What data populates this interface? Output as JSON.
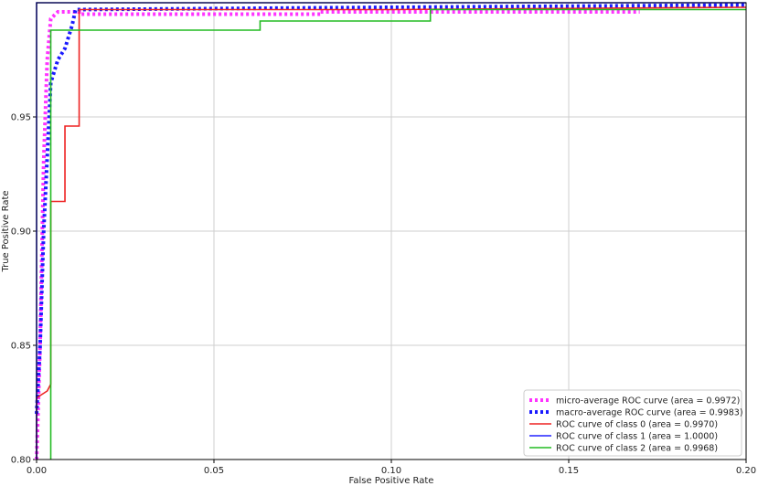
{
  "chart_data": {
    "type": "line",
    "title": "",
    "xlabel": "False Positive Rate",
    "ylabel": "True Positive Rate",
    "xlim": [
      0.0,
      0.2
    ],
    "ylim": [
      0.8,
      1.0
    ],
    "grid": true,
    "legend_position": "bottom-right",
    "x_ticks": [
      "0.00",
      "0.05",
      "0.10",
      "0.15",
      "0.20"
    ],
    "y_ticks": [
      "0.80",
      "0.85",
      "0.90",
      "0.95"
    ],
    "series": [
      {
        "name": "micro-average ROC curve (area = 0.9972)",
        "color": "#ff33ff",
        "style": "dotted",
        "x": [
          0.0,
          0.001,
          0.002,
          0.003,
          0.004,
          0.006,
          0.012,
          0.012,
          0.08,
          0.08,
          0.17
        ],
        "y": [
          0.8,
          0.85,
          0.93,
          0.975,
          0.993,
          0.996,
          0.996,
          0.995,
          0.995,
          0.996,
          0.996
        ]
      },
      {
        "name": "macro-average ROC curve (area = 0.9983)",
        "color": "#1a1aff",
        "style": "dotted",
        "x": [
          0.0,
          0.001,
          0.002,
          0.004,
          0.006,
          0.008,
          0.01,
          0.011,
          0.1,
          0.2
        ],
        "y": [
          0.82,
          0.85,
          0.9,
          0.965,
          0.975,
          0.98,
          0.99,
          0.997,
          0.998,
          0.999
        ]
      },
      {
        "name": "ROC curve of class 0 (area = 0.9970)",
        "color": "#ee2222",
        "style": "solid",
        "x": [
          0.0,
          0.0,
          0.003,
          0.003,
          0.004,
          0.004,
          0.008,
          0.008,
          0.012,
          0.012,
          0.1,
          0.2
        ],
        "y": [
          0.8,
          0.827,
          0.83,
          0.83,
          0.833,
          0.913,
          0.913,
          0.946,
          0.946,
          0.997,
          0.997,
          0.998
        ]
      },
      {
        "name": "ROC curve of class 1 (area = 1.0000)",
        "color": "#2222ff",
        "style": "solid",
        "x": [
          0.0,
          0.0,
          0.2
        ],
        "y": [
          0.8,
          1.0,
          1.0
        ]
      },
      {
        "name": "ROC curve of class 2 (area = 0.9968)",
        "color": "#22bb22",
        "style": "solid",
        "x": [
          0.004,
          0.004,
          0.063,
          0.063,
          0.111,
          0.111,
          0.2
        ],
        "y": [
          0.8,
          0.988,
          0.988,
          0.992,
          0.992,
          0.997,
          0.997
        ]
      }
    ]
  }
}
